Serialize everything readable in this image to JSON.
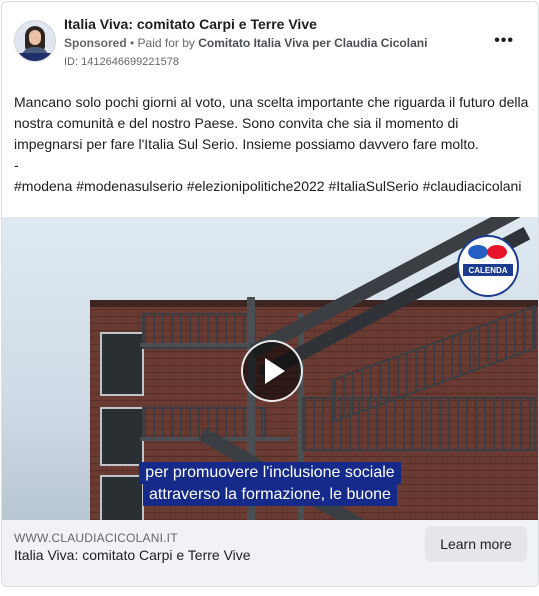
{
  "post": {
    "page_name": "Italia Viva: comitato Carpi e Terre Vive",
    "sponsored": "Sponsored",
    "paid_for_prefix": "• Paid for by",
    "funder": "Comitato Italia Viva per Claudia Cicolani",
    "ad_id": "ID: 1412646699221578",
    "more_icon": "more-horizontal-icon",
    "body": "Mancano solo pochi giorni al voto, una scelta importante che riguarda il futuro della nostra comunità e del nostro Paese. Sono convita che sia il momento di impegnarsi per fare l'Italia Sul Serio. Insieme possiamo davvero fare molto.\n-\n#modena #modenasulserio #elezionipolitiche2022 #ItaliaSulSerio #claudiacicolani"
  },
  "media": {
    "logo_text": "CALENDA",
    "logo_subtext": "",
    "play_icon": "play-icon",
    "subtitle_line1": "per promuovere l'inclusione sociale",
    "subtitle_line2": "attraverso la formazione, le buone"
  },
  "footer": {
    "domain": "WWW.CLAUDIACICOLANI.IT",
    "title": "Italia Viva: comitato Carpi e Terre Vive",
    "cta_label": "Learn more"
  },
  "colors": {
    "subtitle_bg": "#162a8a",
    "footer_bg": "#f0f2f5",
    "button_bg": "#e4e6eb"
  }
}
